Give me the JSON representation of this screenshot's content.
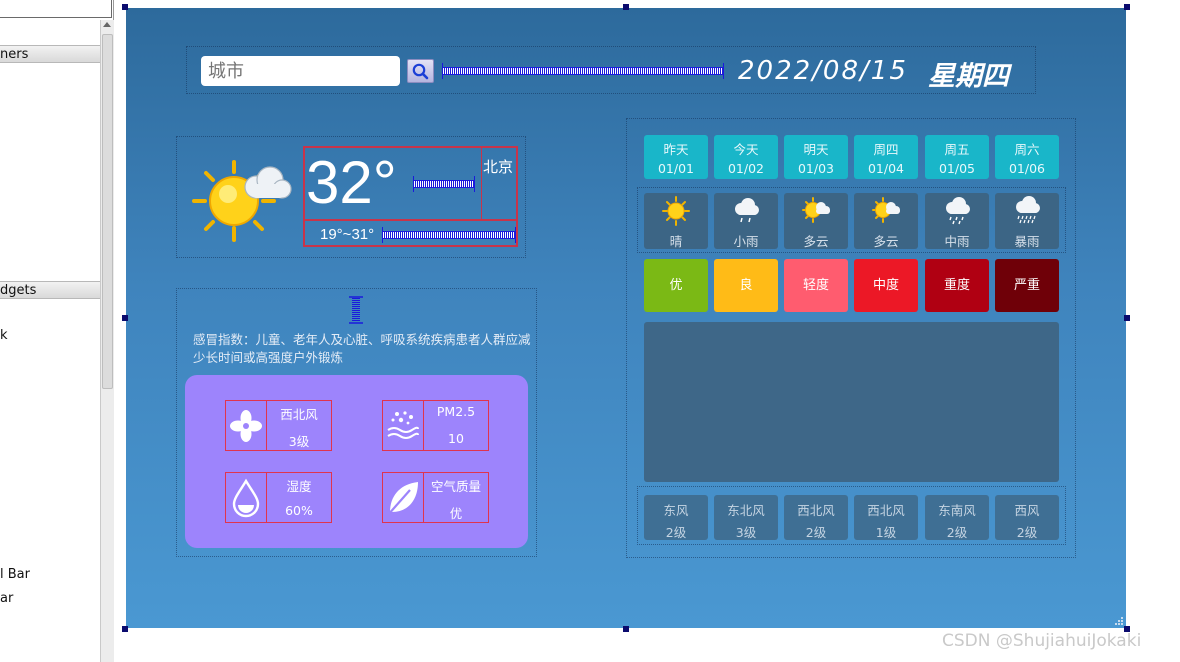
{
  "designer": {
    "sections": [
      "ners",
      "dgets"
    ],
    "items": [
      "k",
      "l Bar",
      "ar"
    ]
  },
  "header": {
    "city_placeholder": "城市",
    "date": "2022/08/15",
    "weekday": "星期四"
  },
  "current": {
    "temperature": "32°",
    "city": "北京",
    "range": "19°~31°",
    "weather_icon": "sun-cloud-icon",
    "cold_index": "感冒指数：儿童、老年人及心脏、呼吸系统疾病患者人群应减少长时间或高强度户外锻炼"
  },
  "info": [
    {
      "label": "西北风",
      "value": "3级",
      "icon": "fan-icon"
    },
    {
      "label": "PM2.5",
      "value": "10",
      "icon": "pm25-icon"
    },
    {
      "label": "湿度",
      "value": "60%",
      "icon": "drop-icon"
    },
    {
      "label": "空气质量",
      "value": "优",
      "icon": "leaf-icon"
    }
  ],
  "forecast": {
    "days": [
      {
        "name": "昨天",
        "date": "01/01"
      },
      {
        "name": "今天",
        "date": "01/02"
      },
      {
        "name": "明天",
        "date": "01/03"
      },
      {
        "name": "周四",
        "date": "01/04"
      },
      {
        "name": "周五",
        "date": "01/05"
      },
      {
        "name": "周六",
        "date": "01/06"
      }
    ],
    "weather": [
      {
        "label": "晴",
        "icon": "sun-icon"
      },
      {
        "label": "小雨",
        "icon": "light-rain-icon"
      },
      {
        "label": "多云",
        "icon": "partly-cloudy-icon"
      },
      {
        "label": "多云",
        "icon": "partly-cloudy-icon"
      },
      {
        "label": "中雨",
        "icon": "moderate-rain-icon"
      },
      {
        "label": "暴雨",
        "icon": "heavy-rain-icon"
      }
    ],
    "aqi": [
      {
        "label": "优",
        "color": "#7bb915"
      },
      {
        "label": "良",
        "color": "#ffbb17"
      },
      {
        "label": "轻度",
        "color": "#ff5c6f"
      },
      {
        "label": "中度",
        "color": "#ec1826"
      },
      {
        "label": "重度",
        "color": "#b00012"
      },
      {
        "label": "严重",
        "color": "#6f0008"
      }
    ],
    "wind": [
      {
        "dir": "东风",
        "level": "2级"
      },
      {
        "dir": "东北风",
        "level": "3级"
      },
      {
        "dir": "西北风",
        "level": "2级"
      },
      {
        "dir": "西北风",
        "level": "1级"
      },
      {
        "dir": "东南风",
        "level": "2级"
      },
      {
        "dir": "西风",
        "level": "2级"
      }
    ]
  },
  "watermark": "CSDN @ShujiahuiJokaki"
}
